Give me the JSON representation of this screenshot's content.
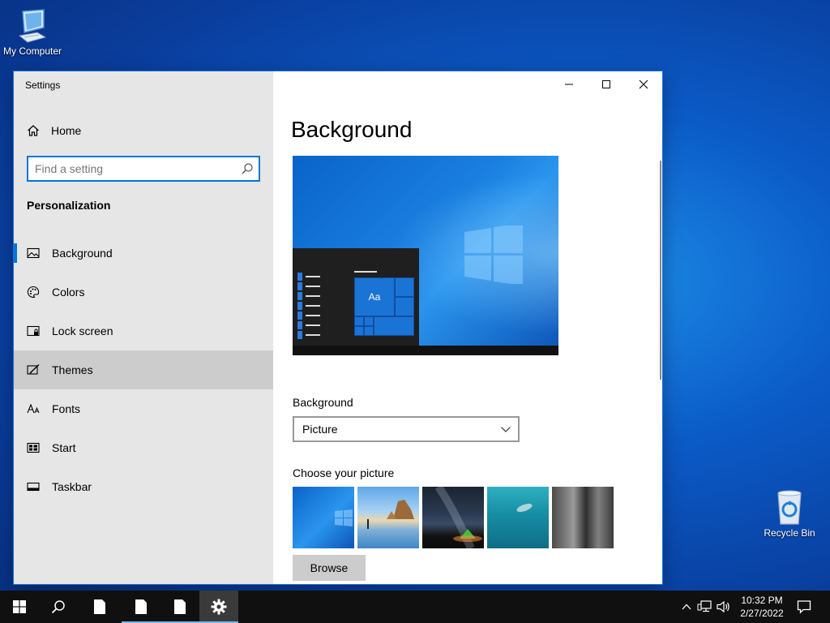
{
  "desktop": {
    "icons": [
      {
        "label": "My Computer",
        "icon": "computer-icon"
      },
      {
        "label": "Recycle Bin",
        "icon": "recycle-bin-icon"
      }
    ]
  },
  "window": {
    "title": "Settings",
    "sidebar": {
      "home_label": "Home",
      "search_placeholder": "Find a setting",
      "search_value": "",
      "section_title": "Personalization",
      "items": [
        {
          "label": "Background",
          "icon": "picture-icon",
          "selected": true
        },
        {
          "label": "Colors",
          "icon": "palette-icon"
        },
        {
          "label": "Lock screen",
          "icon": "lock-screen-icon"
        },
        {
          "label": "Themes",
          "icon": "themes-icon",
          "hover": true
        },
        {
          "label": "Fonts",
          "icon": "fonts-icon"
        },
        {
          "label": "Start",
          "icon": "start-icon"
        },
        {
          "label": "Taskbar",
          "icon": "taskbar-icon"
        }
      ]
    },
    "main": {
      "title": "Background",
      "preview_tile_text": "Aa",
      "background_label": "Background",
      "background_selected": "Picture",
      "choose_label": "Choose your picture",
      "browse_label": "Browse"
    }
  },
  "taskbar": {
    "time": "10:32 PM",
    "date": "2/27/2022"
  },
  "colors": {
    "accent": "#0078d7",
    "sidebar_bg": "#e6e6e6",
    "taskbar_bg": "#101010"
  }
}
